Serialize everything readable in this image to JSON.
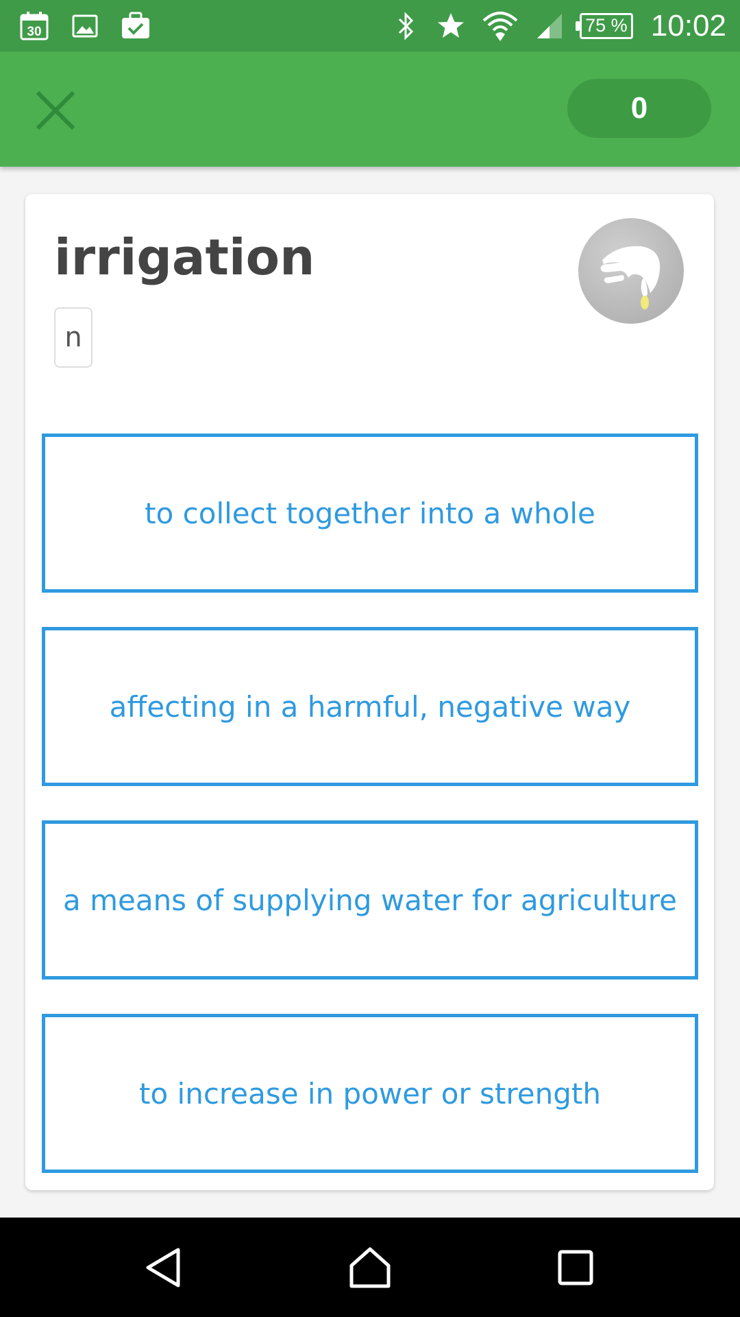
{
  "status_bar": {
    "left_icons": [
      "calendar-icon",
      "image-icon",
      "briefcase-check-icon"
    ],
    "calendar_day": "30",
    "right_icons": [
      "bluetooth-icon",
      "star-icon",
      "wifi-icon",
      "signal-icon"
    ],
    "battery": "75 %",
    "time": "10:02"
  },
  "app_bar": {
    "close_icon": "close-icon",
    "score": "0"
  },
  "question": {
    "word": "irrigation",
    "part_of_speech": "n",
    "hint_icon": "hint-hand-icon"
  },
  "options": [
    "to collect together into a whole",
    "affecting in a harmful, negative way",
    "a means of supplying water for agriculture",
    "to increase in power or strength"
  ],
  "nav_bar": {
    "back_icon": "back-icon",
    "home_icon": "home-icon",
    "recents_icon": "recents-icon"
  },
  "colors": {
    "status_bar": "#3f9b48",
    "app_bar": "#4caf50",
    "score_pill": "#3d9b43",
    "option_accent": "#2f9ae0"
  }
}
